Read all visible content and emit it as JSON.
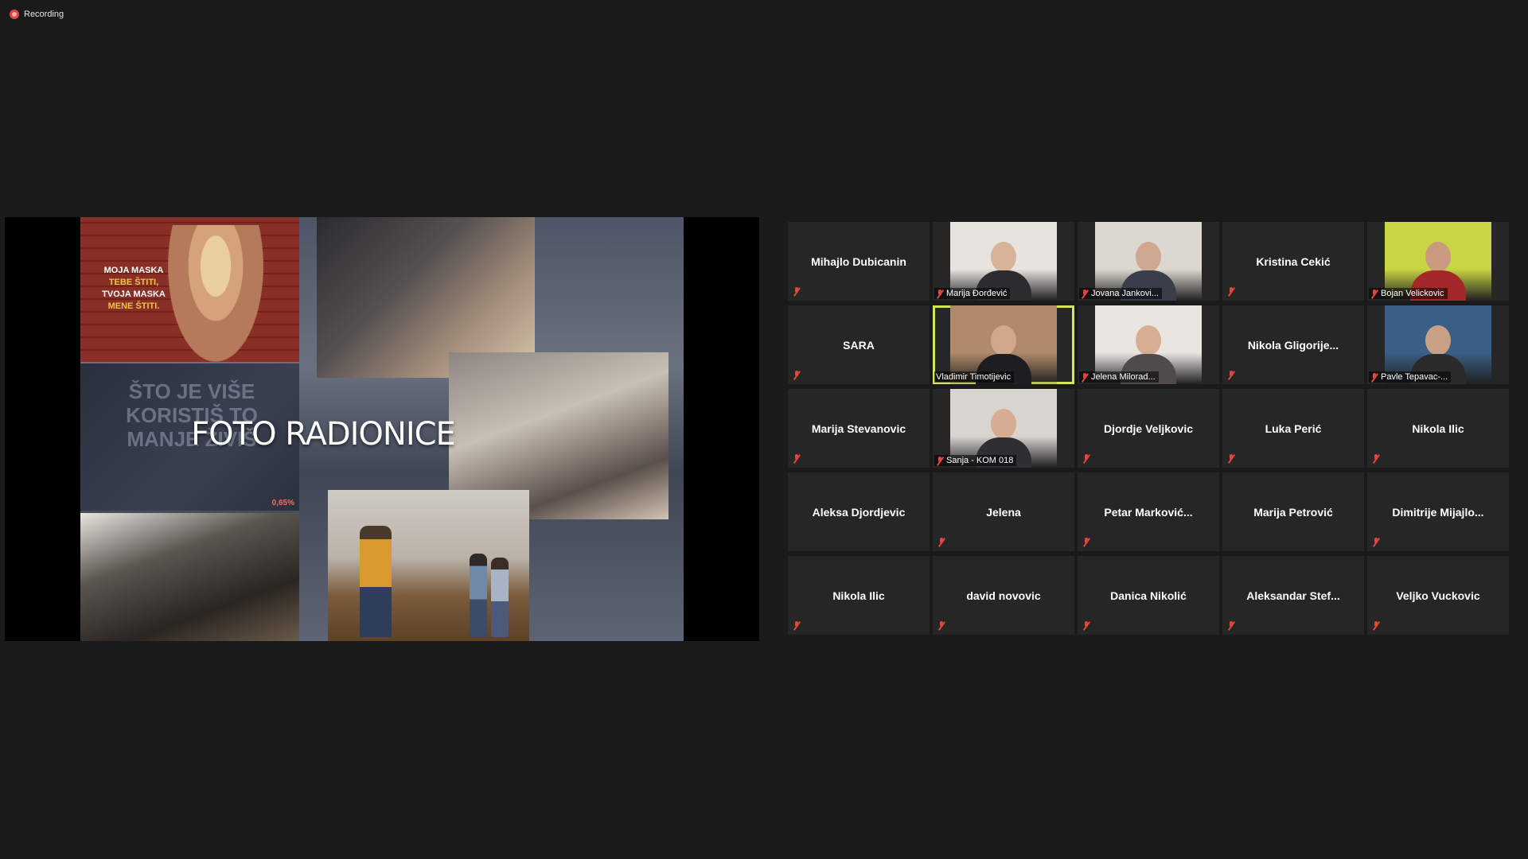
{
  "recording": {
    "label": "Recording",
    "icon": "record-dot-icon",
    "color": "#e0453a"
  },
  "shared_screen": {
    "title": "FOTO RADIONICE",
    "poster_text_lines": [
      "MOJA MASKA",
      "TEBE ŠTITI,",
      "TVOJA MASKA",
      "MENE ŠTITI."
    ],
    "poster_highlight_color": "#f1c24a",
    "overlay_text": "ŠTO JE VIŠE KORISTIŠ TO MANJE ŽIVIŠ",
    "stat_text": "0,65%"
  },
  "active_speaker_color": "#d7e35f",
  "participants": [
    {
      "name": "Mihajlo Dubicanin",
      "video": false,
      "muted": true,
      "speaking": false
    },
    {
      "name": "Marija Đorđević",
      "video": true,
      "muted": true,
      "speaking": false,
      "bg": "#e7e3de",
      "skin": "#d8b39a",
      "shirt": "#2c2c30"
    },
    {
      "name": "Jovana Jankovi...",
      "video": true,
      "muted": true,
      "speaking": false,
      "bg": "#dcd8cf",
      "skin": "#cfa892",
      "shirt": "#3a3d4a"
    },
    {
      "name": "Kristina Cekić",
      "video": false,
      "muted": true,
      "speaking": false
    },
    {
      "name": "Bojan Velickovic",
      "video": true,
      "muted": true,
      "speaking": false,
      "bg": "#c9d443",
      "skin": "#c89a80",
      "shirt": "#a4272a"
    },
    {
      "name": "SARA",
      "video": false,
      "muted": true,
      "speaking": false
    },
    {
      "name": "Vladimir Timotijevic",
      "video": true,
      "muted": false,
      "speaking": true,
      "bg": "#b08a6a",
      "skin": "#d2a88c",
      "shirt": "#1e1e22"
    },
    {
      "name": "Jelena Milorad...",
      "video": true,
      "muted": true,
      "speaking": false,
      "bg": "#e9e6e2",
      "skin": "#d6ae94",
      "shirt": "#4e4b4a"
    },
    {
      "name": "Nikola  Gligorije...",
      "video": false,
      "muted": true,
      "speaking": false
    },
    {
      "name": "Pavle Tepavac-...",
      "video": true,
      "muted": true,
      "speaking": false,
      "bg": "#3a5f86",
      "skin": "#c9a085",
      "shirt": "#2a2a2a"
    },
    {
      "name": "Marija Stevanovic",
      "video": false,
      "muted": true,
      "speaking": false
    },
    {
      "name": "Sanja - KOM 018",
      "video": true,
      "muted": true,
      "speaking": false,
      "bg": "#d8d5d0",
      "skin": "#d6ad93",
      "shirt": "#2f2f33"
    },
    {
      "name": "Djordje Veljkovic",
      "video": false,
      "muted": true,
      "speaking": false
    },
    {
      "name": "Luka Perić",
      "video": false,
      "muted": true,
      "speaking": false
    },
    {
      "name": "Nikola Ilic",
      "video": false,
      "muted": true,
      "speaking": false
    },
    {
      "name": "Aleksa Djordjevic",
      "video": false,
      "muted": false,
      "speaking": false
    },
    {
      "name": "Jelena",
      "video": false,
      "muted": true,
      "speaking": false
    },
    {
      "name": "Petar  Marković...",
      "video": false,
      "muted": true,
      "speaking": false
    },
    {
      "name": "Marija Petrović",
      "video": false,
      "muted": false,
      "speaking": false
    },
    {
      "name": "Dimitrije  Mijajlo...",
      "video": false,
      "muted": true,
      "speaking": false
    },
    {
      "name": "Nikola Ilic",
      "video": false,
      "muted": true,
      "speaking": false
    },
    {
      "name": "david novovic",
      "video": false,
      "muted": true,
      "speaking": false
    },
    {
      "name": "Danica Nikolić",
      "video": false,
      "muted": true,
      "speaking": false
    },
    {
      "name": "Aleksandar  Stef...",
      "video": false,
      "muted": true,
      "speaking": false
    },
    {
      "name": "Veljko Vuckovic",
      "video": false,
      "muted": true,
      "speaking": false
    }
  ]
}
